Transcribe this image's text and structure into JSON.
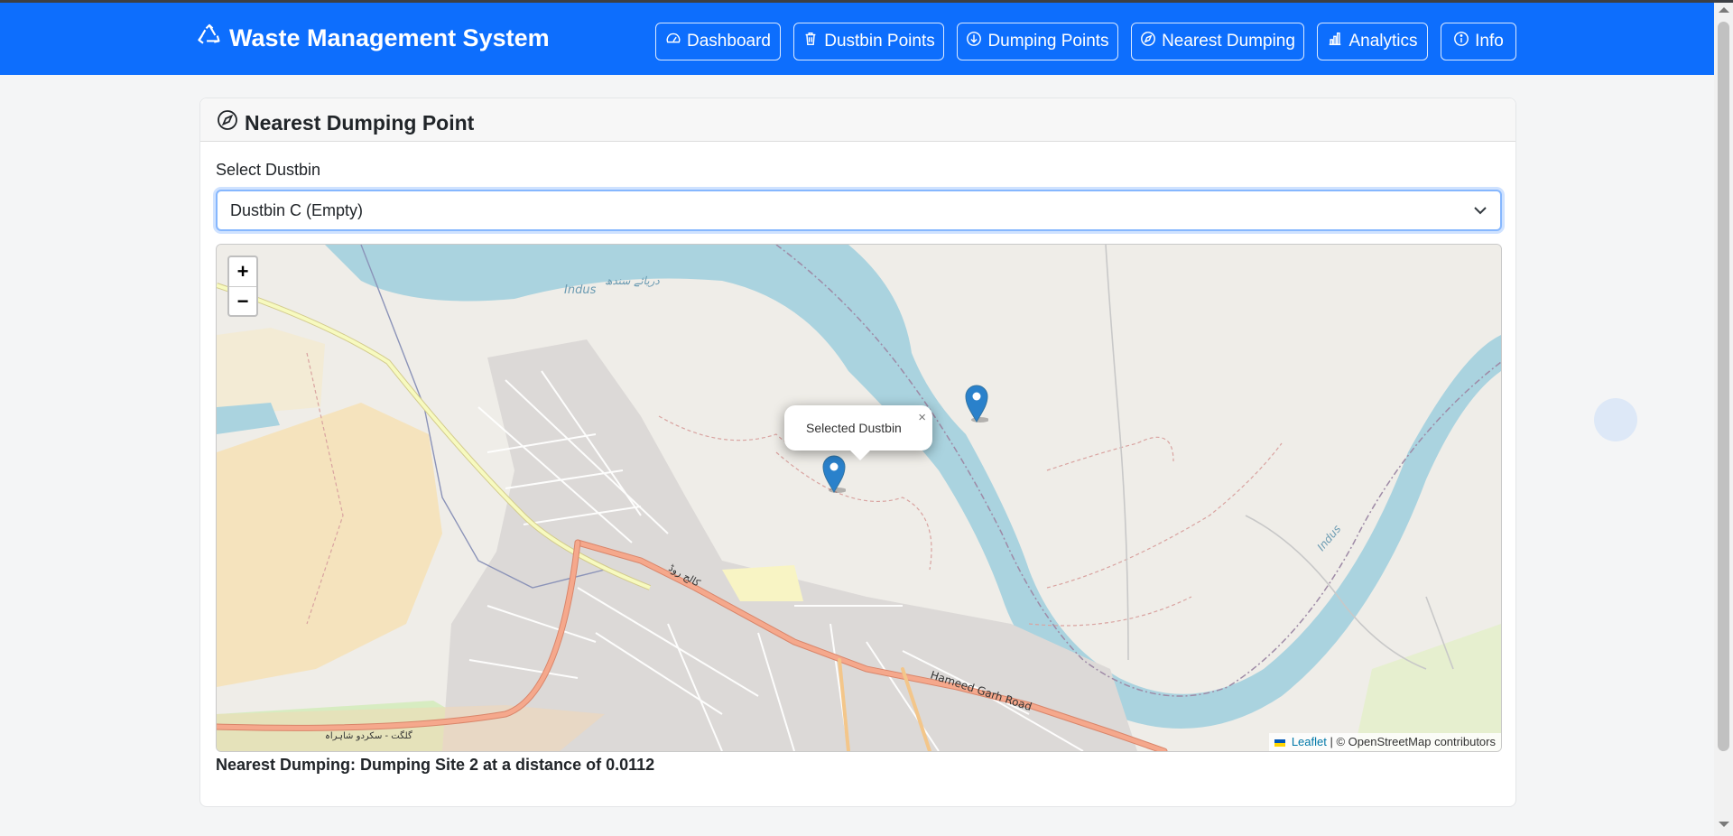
{
  "app": {
    "title": "Waste Management System"
  },
  "nav": {
    "items": [
      {
        "label": "Dashboard",
        "icon": "speedometer-icon"
      },
      {
        "label": "Dustbin Points",
        "icon": "trash-icon"
      },
      {
        "label": "Dumping Points",
        "icon": "download-circle-icon"
      },
      {
        "label": "Nearest Dumping",
        "icon": "compass-icon"
      },
      {
        "label": "Analytics",
        "icon": "bar-chart-icon"
      },
      {
        "label": "Info",
        "icon": "info-circle-icon"
      }
    ]
  },
  "card": {
    "title": "Nearest Dumping Point",
    "icon": "compass-icon"
  },
  "form": {
    "label": "Select Dustbin",
    "selected": "Dustbin C (Empty)"
  },
  "map": {
    "zoom_in": "+",
    "zoom_out": "−",
    "popup_text": "Selected Dustbin",
    "popup_close": "×",
    "attribution_link": "Leaflet",
    "attribution_text": "| © OpenStreetMap contributors",
    "labels": {
      "river_indus": "Indus",
      "river_indus_urdu": "دریائے سندھ",
      "river_indus_east": "Indus",
      "road_hameed_garh": "Hameed Garh Road",
      "road_college": "کالج روڈ",
      "road_gilgit": "گلگت - سکردو شاہراہ"
    }
  },
  "result": {
    "text": "Nearest Dumping: Dumping Site 2 at a distance of 0.0112"
  },
  "colors": {
    "primary": "#0d6efd",
    "water": "#aad3df",
    "marker": "#2a81cb",
    "main_road": "#f5a88c",
    "secondary_road": "#f7fabf"
  }
}
